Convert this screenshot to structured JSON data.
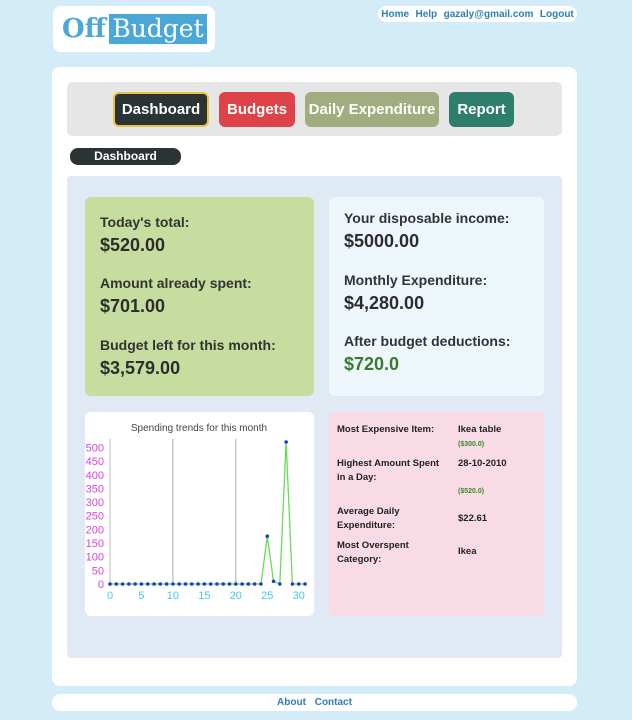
{
  "logo": {
    "part1": "Off",
    "part2": "Budget"
  },
  "topnav": {
    "home": "Home",
    "help": "Help",
    "email": "gazaly@gmail.com",
    "logout": "Logout"
  },
  "tabs": {
    "dashboard": "Dashboard",
    "budgets": "Budgets",
    "daily": "Daily Expenditure",
    "report": "Report"
  },
  "breadcrumb": "Dashboard",
  "summary_left": {
    "todays_total_label": "Today's total:",
    "todays_total_value": "$520.00",
    "spent_label": "Amount already spent:",
    "spent_value": "$701.00",
    "left_label": "Budget left for this month:",
    "left_value": "$3,579.00"
  },
  "summary_right": {
    "income_label": "Your disposable income:",
    "income_value": "$5000.00",
    "monthly_label": "Monthly Expenditure:",
    "monthly_value": "$4,280.00",
    "after_label": "After budget deductions:",
    "after_value": "$720.0"
  },
  "stats": {
    "expensive_label": "Most Expensive Item:",
    "expensive_value": "Ikea table",
    "expensive_sub": "($300.0)",
    "highest_label": "Highest Amount Spent in a Day:",
    "highest_value": "28-10-2010",
    "highest_sub": "($520.0)",
    "average_label": "Average Daily Expenditure:",
    "average_value": "$22.61",
    "overspent_label": "Most Overspent Category:",
    "overspent_value": "Ikea"
  },
  "colors": {
    "series_line": "#66dd55",
    "series_point": "#1f3fb8",
    "y_tick": "#d844d8",
    "x_tick": "#44c8e8"
  },
  "chart_data": {
    "type": "line",
    "title": "Spending trends for this month",
    "xlabel": "",
    "ylabel": "",
    "x": [
      0,
      1,
      2,
      3,
      4,
      5,
      6,
      7,
      8,
      9,
      10,
      11,
      12,
      13,
      14,
      15,
      16,
      17,
      18,
      19,
      20,
      21,
      22,
      23,
      24,
      25,
      26,
      27,
      28,
      29,
      30,
      31
    ],
    "y": [
      0,
      0,
      0,
      0,
      0,
      0,
      0,
      0,
      0,
      0,
      0,
      0,
      0,
      0,
      0,
      0,
      0,
      0,
      0,
      0,
      0,
      0,
      0,
      0,
      0,
      175,
      10,
      0,
      520,
      0,
      0,
      0
    ],
    "x_ticks": [
      "0",
      "5",
      "10",
      "15",
      "20",
      "25",
      "30"
    ],
    "y_ticks": [
      "0",
      "50",
      "100",
      "150",
      "200",
      "250",
      "300",
      "350",
      "400",
      "450",
      "500"
    ],
    "xlim": [
      0,
      31
    ],
    "ylim": [
      0,
      520
    ],
    "grid": "vertical"
  },
  "footer": {
    "about": "About",
    "contact": "Contact"
  }
}
